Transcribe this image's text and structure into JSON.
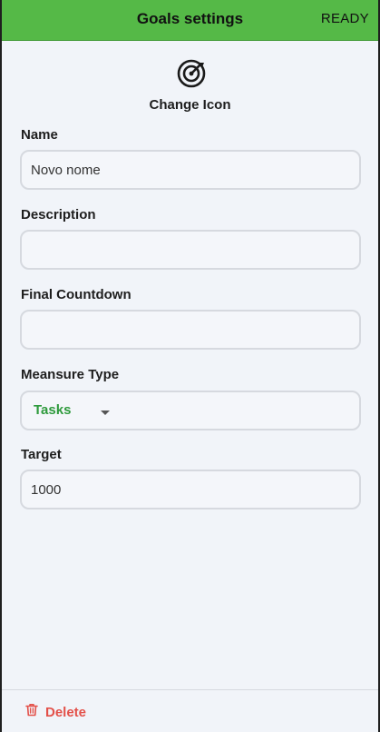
{
  "header": {
    "title": "Goals settings",
    "action_label": "READY"
  },
  "icon_section": {
    "icon": "target-icon",
    "change_label": "Change Icon"
  },
  "fields": {
    "name": {
      "label": "Name",
      "value": "Novo nome"
    },
    "description": {
      "label": "Description",
      "value": ""
    },
    "final_countdown": {
      "label": "Final Countdown",
      "value": ""
    },
    "measure_type": {
      "label": "Meansure Type",
      "value": "Tasks"
    },
    "target": {
      "label": "Target",
      "value": "1000"
    }
  },
  "footer": {
    "delete_label": "Delete",
    "delete_icon": "trash-icon"
  },
  "colors": {
    "header_bg": "#55b947",
    "select_value": "#2e9a3c",
    "delete": "#e3514a",
    "background": "#f1f4f9"
  }
}
